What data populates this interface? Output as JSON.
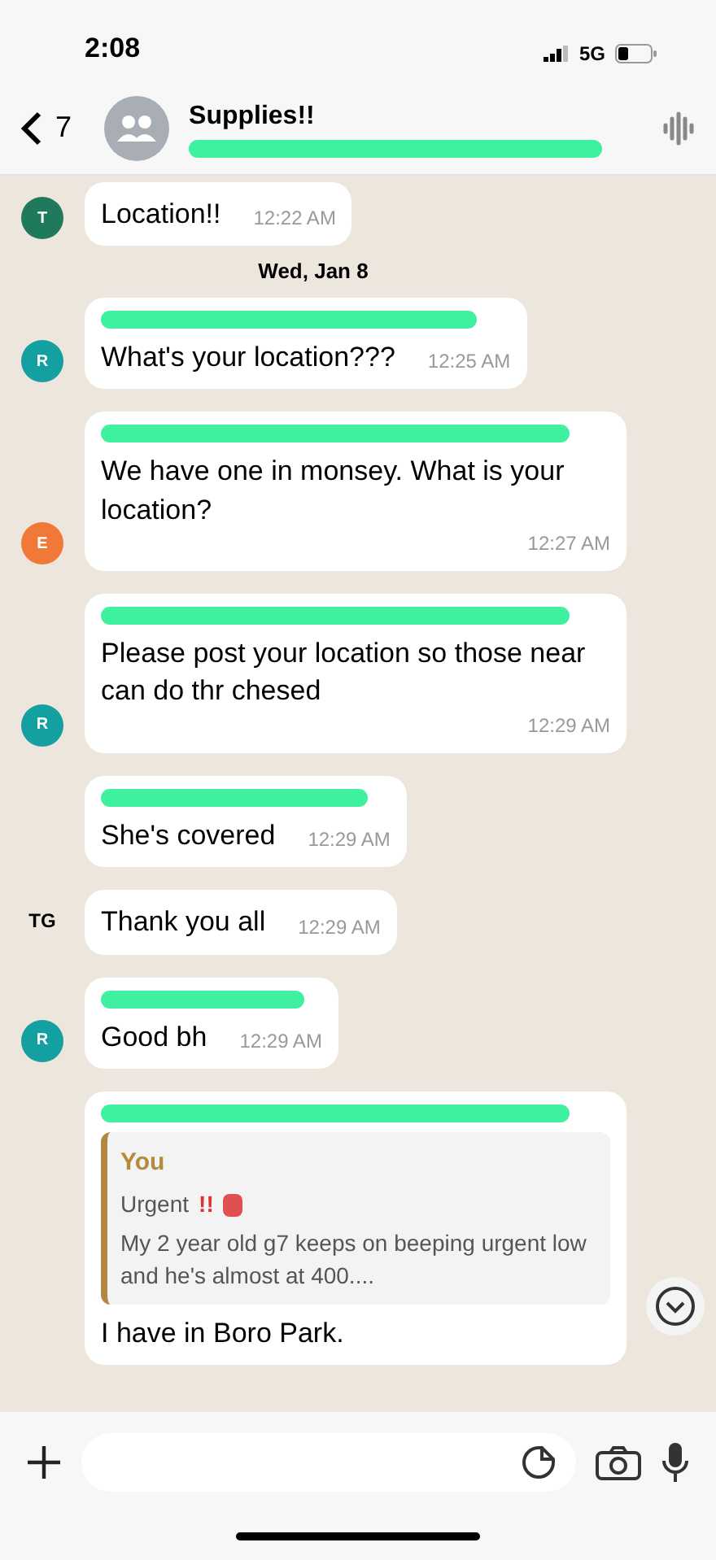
{
  "status_bar": {
    "time": "2:08",
    "network": "5G"
  },
  "header": {
    "back_count": "7",
    "title": "Supplies!!",
    "subtitle_redacted": true
  },
  "messages": [
    {
      "kind": "text",
      "redacted_sender": false,
      "text": "Location!!",
      "time": "12:22 AM",
      "avatar": {
        "letter": "T",
        "color": "#1f7a5c"
      }
    },
    {
      "kind": "date",
      "text": "Wed, Jan 8"
    },
    {
      "kind": "text",
      "redacted_sender": true,
      "text": "What's your location???",
      "time": "12:25 AM",
      "avatar": {
        "letter": "R",
        "color": "#14a0a0"
      }
    },
    {
      "kind": "text",
      "redacted_sender": true,
      "text": "We have one in monsey. What is your location?",
      "time": "12:27 AM",
      "avatar": {
        "letter": "E",
        "color": "#f07838"
      }
    },
    {
      "kind": "text",
      "redacted_sender": true,
      "text": "Please post your location so those near can do thr chesed",
      "time": "12:29 AM",
      "avatar": {
        "letter": "R",
        "color": "#14a0a0"
      }
    },
    {
      "kind": "text",
      "redacted_sender": true,
      "text": "She's covered",
      "time": "12:29 AM"
    },
    {
      "kind": "text",
      "redacted_sender": false,
      "text": "Thank you all",
      "time": "12:29 AM",
      "initials": "TG"
    },
    {
      "kind": "text",
      "redacted_sender": true,
      "text": "Good bh",
      "time": "12:29 AM",
      "avatar": {
        "letter": "R",
        "color": "#14a0a0"
      }
    },
    {
      "kind": "reply",
      "redacted_sender": true,
      "quote": {
        "author": "You",
        "title": "Urgent",
        "mark": "!!",
        "body": "My 2 year old g7 keeps on beeping urgent low and he's almost at 400...."
      },
      "text": "I have in Boro Park."
    }
  ]
}
